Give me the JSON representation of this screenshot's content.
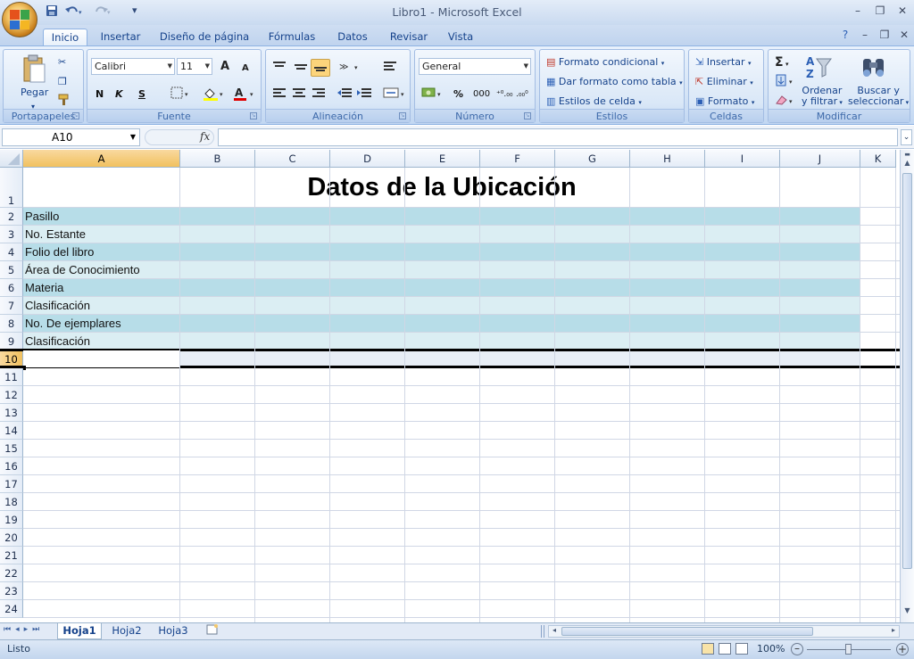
{
  "window": {
    "title": "Libro1 - Microsoft Excel"
  },
  "quick_access": {
    "save_icon": "save-icon",
    "undo_icon": "undo-icon",
    "redo_icon": "redo-icon",
    "customize": "▾"
  },
  "ribbon_tabs": [
    "Inicio",
    "Insertar",
    "Diseño de página",
    "Fórmulas",
    "Datos",
    "Revisar",
    "Vista"
  ],
  "groups": {
    "portapapeles": {
      "label": "Portapapeles",
      "paste": "Pegar"
    },
    "fuente": {
      "label": "Fuente",
      "font": "Calibri",
      "size": "11",
      "bold": "N",
      "italic": "K",
      "underline": "S",
      "grow": "A",
      "shrink": "A",
      "font_color": "A"
    },
    "alineacion": {
      "label": "Alineación"
    },
    "numero": {
      "label": "Número",
      "format": "General",
      "percent": "%",
      "thousands": "000",
      "inc_dec": "⁺⁰.₀₀",
      "dec_dec": ".₀₀⁰"
    },
    "estilos": {
      "label": "Estilos",
      "cond": "Formato condicional",
      "table": "Dar formato como tabla",
      "cell": "Estilos de celda"
    },
    "celdas": {
      "label": "Celdas",
      "insert": "Insertar",
      "delete": "Eliminar",
      "format": "Formato"
    },
    "modificar": {
      "label": "Modificar",
      "sigma": "Σ",
      "sort": "Ordenar",
      "sort2": "y filtrar",
      "find": "Buscar y",
      "find2": "seleccionar"
    }
  },
  "formula_bar": {
    "name_box": "A10",
    "fx": "fx",
    "formula": ""
  },
  "columns": [
    "A",
    "B",
    "C",
    "D",
    "E",
    "F",
    "G",
    "H",
    "I",
    "J",
    "K"
  ],
  "rows": [
    "1",
    "2",
    "3",
    "4",
    "5",
    "6",
    "7",
    "8",
    "9",
    "10",
    "11",
    "12",
    "13",
    "14",
    "15",
    "16",
    "17",
    "18",
    "19",
    "20",
    "21",
    "22",
    "23",
    "24"
  ],
  "sheet_title": "Datos de la Ubicación",
  "cells": [
    "Pasillo",
    "No. Estante",
    "Folio del libro",
    "Área de Conocimiento",
    "Materia",
    "Clasificación",
    "No. De ejemplares",
    "Clasificación"
  ],
  "sheets": [
    "Hoja1",
    "Hoja2",
    "Hoja3"
  ],
  "status": {
    "text": "Listo",
    "zoom": "100%"
  },
  "colors": {
    "band_dark": "#b7dde8",
    "band_light": "#dbeef3",
    "accent": "#15428b"
  }
}
